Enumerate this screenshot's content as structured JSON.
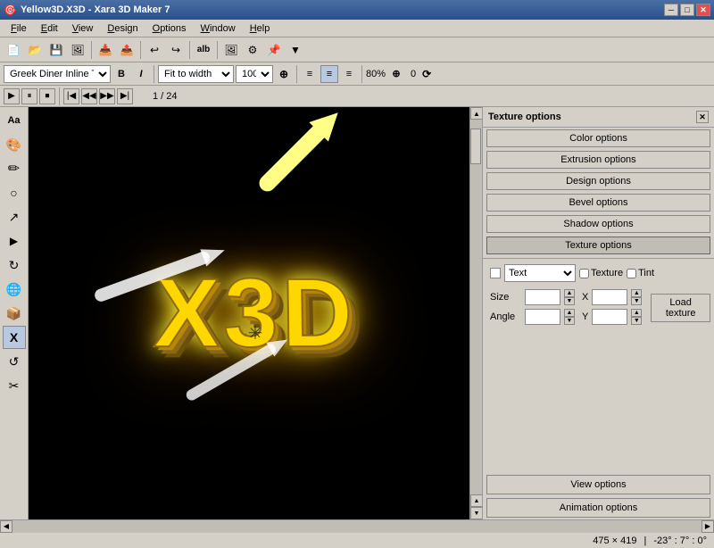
{
  "window": {
    "title": "Yellow3D.X3D - Xara 3D Maker 7",
    "minimize_label": "─",
    "maximize_label": "□",
    "close_label": "✕"
  },
  "menu": {
    "items": [
      "File",
      "Edit",
      "View",
      "Design",
      "Options",
      "Window",
      "Help"
    ]
  },
  "toolbar": {
    "buttons": [
      "📄",
      "📂",
      "💾",
      "✂️",
      "📋",
      "↩",
      "↪",
      "alb",
      "🖼",
      "🔧",
      "📌",
      "▼"
    ]
  },
  "toolbar2": {
    "font": "Greek Diner Inline TT",
    "bold": "B",
    "italic": "I",
    "fit_to_width": "Fit to width",
    "zoom": "100%",
    "align_left": "≡",
    "align_center": "≡",
    "align_right": "≡",
    "zoom2": "80%",
    "rotation": "0"
  },
  "playback": {
    "play": "▶",
    "pause": "⏸",
    "stop": "⏹",
    "first": "⏮",
    "prev": "◀◀",
    "next": "▶▶",
    "last": "⏭",
    "frame": "1 / 24"
  },
  "left_tools": {
    "icons": [
      "Aa",
      "🎨",
      "✏️",
      "⭕",
      "✏",
      "▶",
      "🔄",
      "🌐",
      "📦",
      "X",
      "↺",
      "✂"
    ]
  },
  "right_panel": {
    "title": "Texture options",
    "close": "✕",
    "buttons": [
      "Color options",
      "Extrusion options",
      "Design options",
      "Bevel options",
      "Shadow options",
      "Texture options"
    ],
    "texture_label": "Text",
    "texture_checkbox": "Texture",
    "tint_checkbox": "Tint",
    "size_label": "Size",
    "x_label": "X",
    "angle_label": "Angle",
    "y_label": "Y",
    "load_texture": "Load texture",
    "view_options": "View options",
    "animation_options": "Animation options"
  },
  "status": {
    "dimensions": "475 × 419",
    "angles": "-23° : 7° : 0°"
  },
  "canvas": {
    "text": "X3D",
    "frame": "1 / 24"
  }
}
